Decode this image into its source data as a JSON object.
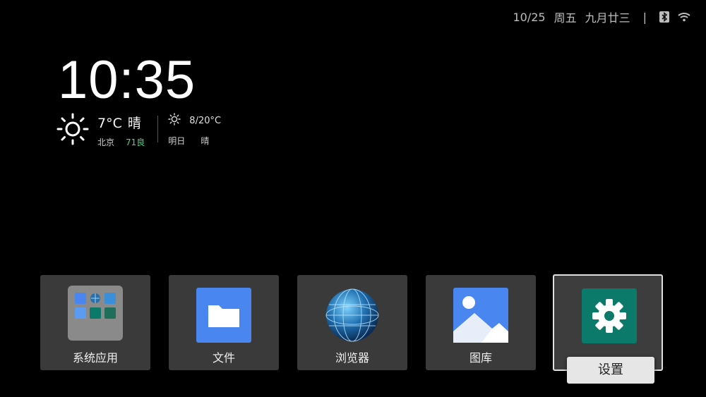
{
  "status_bar": {
    "date": "10/25",
    "weekday": "周五",
    "lunar_date": "九月廿三",
    "separator": "|",
    "icons": [
      "bluetooth-icon",
      "wifi-icon"
    ]
  },
  "clock": {
    "time": "10:35"
  },
  "weather": {
    "now": {
      "icon": "sun-icon",
      "temperature": "7°C",
      "condition": "晴",
      "city": "北京",
      "aqi": "71良"
    },
    "tomorrow": {
      "icon": "sun-icon",
      "temperature_range": "8/20°C",
      "day": "明日",
      "condition": "晴"
    }
  },
  "apps": [
    {
      "label": "系统应用",
      "icon": "system-apps-folder-icon"
    },
    {
      "label": "文件",
      "icon": "files-icon"
    },
    {
      "label": "浏览器",
      "icon": "browser-globe-icon"
    },
    {
      "label": "图库",
      "icon": "gallery-icon"
    },
    {
      "label": "设置",
      "icon": "settings-gear-icon",
      "focused": true
    }
  ],
  "colors": {
    "background": "#000000",
    "tile": "#3a3a3a",
    "aqi_good": "#3ddc84",
    "files_blue": "#4a86f0",
    "settings_teal": "#0b7a6b",
    "focus_label_bg": "#e6e6e6"
  }
}
